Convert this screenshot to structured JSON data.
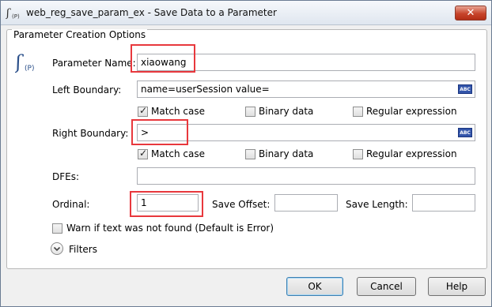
{
  "window": {
    "title": "web_reg_save_param_ex - Save Data to a Parameter",
    "close_glyph": "✕"
  },
  "group": {
    "title": "Parameter Creation Options"
  },
  "fields": {
    "parameter_name": {
      "label": "Parameter Name:",
      "value": "xiaowang"
    },
    "left_boundary": {
      "label": "Left Boundary:",
      "value": "name=userSession value="
    },
    "right_boundary": {
      "label": "Right Boundary:",
      "value": ">"
    },
    "dfes": {
      "label": "DFEs:",
      "value": ""
    },
    "ordinal": {
      "label": "Ordinal:",
      "value": "1"
    },
    "save_offset": {
      "label": "Save Offset:",
      "value": ""
    },
    "save_length": {
      "label": "Save Length:",
      "value": ""
    }
  },
  "left_options": [
    {
      "label": "Match case",
      "checked": true
    },
    {
      "label": "Binary data",
      "checked": false
    },
    {
      "label": "Regular expression",
      "checked": false
    }
  ],
  "right_options": [
    {
      "label": "Match case",
      "checked": true
    },
    {
      "label": "Binary data",
      "checked": false
    },
    {
      "label": "Regular expression",
      "checked": false
    }
  ],
  "warn": {
    "label": "Warn if text was not found (Default is Error)",
    "checked": false
  },
  "filters": {
    "label": "Filters"
  },
  "buttons": {
    "ok": "OK",
    "cancel": "Cancel",
    "help": "Help"
  },
  "editor_badge": "ABC",
  "icons": {
    "app": "function-icon",
    "param": "parameter-icon",
    "chevron": "chevron-down-icon"
  },
  "colors": {
    "highlight": "#e8383d",
    "badge": "#3355aa"
  }
}
